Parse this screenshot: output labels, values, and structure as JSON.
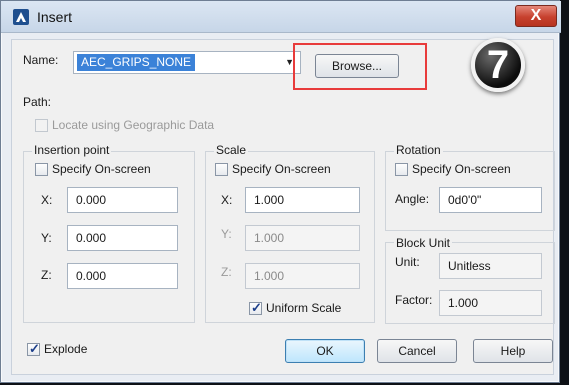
{
  "window": {
    "title": "Insert",
    "close_label": "X"
  },
  "name": {
    "label": "Name:",
    "value": "AEC_GRIPS_NONE",
    "browse_label": "Browse..."
  },
  "path": {
    "label": "Path:",
    "geo_label": "Locate using Geographic Data"
  },
  "insertion": {
    "title": "Insertion point",
    "specify_label": "Specify On-screen",
    "x_label": "X:",
    "x_value": "0.000",
    "y_label": "Y:",
    "y_value": "0.000",
    "z_label": "Z:",
    "z_value": "0.000"
  },
  "scale": {
    "title": "Scale",
    "specify_label": "Specify On-screen",
    "x_label": "X:",
    "x_value": "1.000",
    "y_label": "Y:",
    "y_value": "1.000",
    "z_label": "Z:",
    "z_value": "1.000",
    "uniform_label": "Uniform Scale",
    "uniform_checked": true
  },
  "rotation": {
    "title": "Rotation",
    "specify_label": "Specify On-screen",
    "angle_label": "Angle:",
    "angle_value": "0d0'0\""
  },
  "block_unit": {
    "title": "Block Unit",
    "unit_label": "Unit:",
    "unit_value": "Unitless",
    "factor_label": "Factor:",
    "factor_value": "1.000"
  },
  "explode": {
    "label": "Explode",
    "checked": true
  },
  "buttons": {
    "ok": "OK",
    "cancel": "Cancel",
    "help": "Help"
  },
  "step_badge": "7",
  "colors": {
    "accent": "#3b82d8",
    "highlight": "#e83b3b"
  }
}
